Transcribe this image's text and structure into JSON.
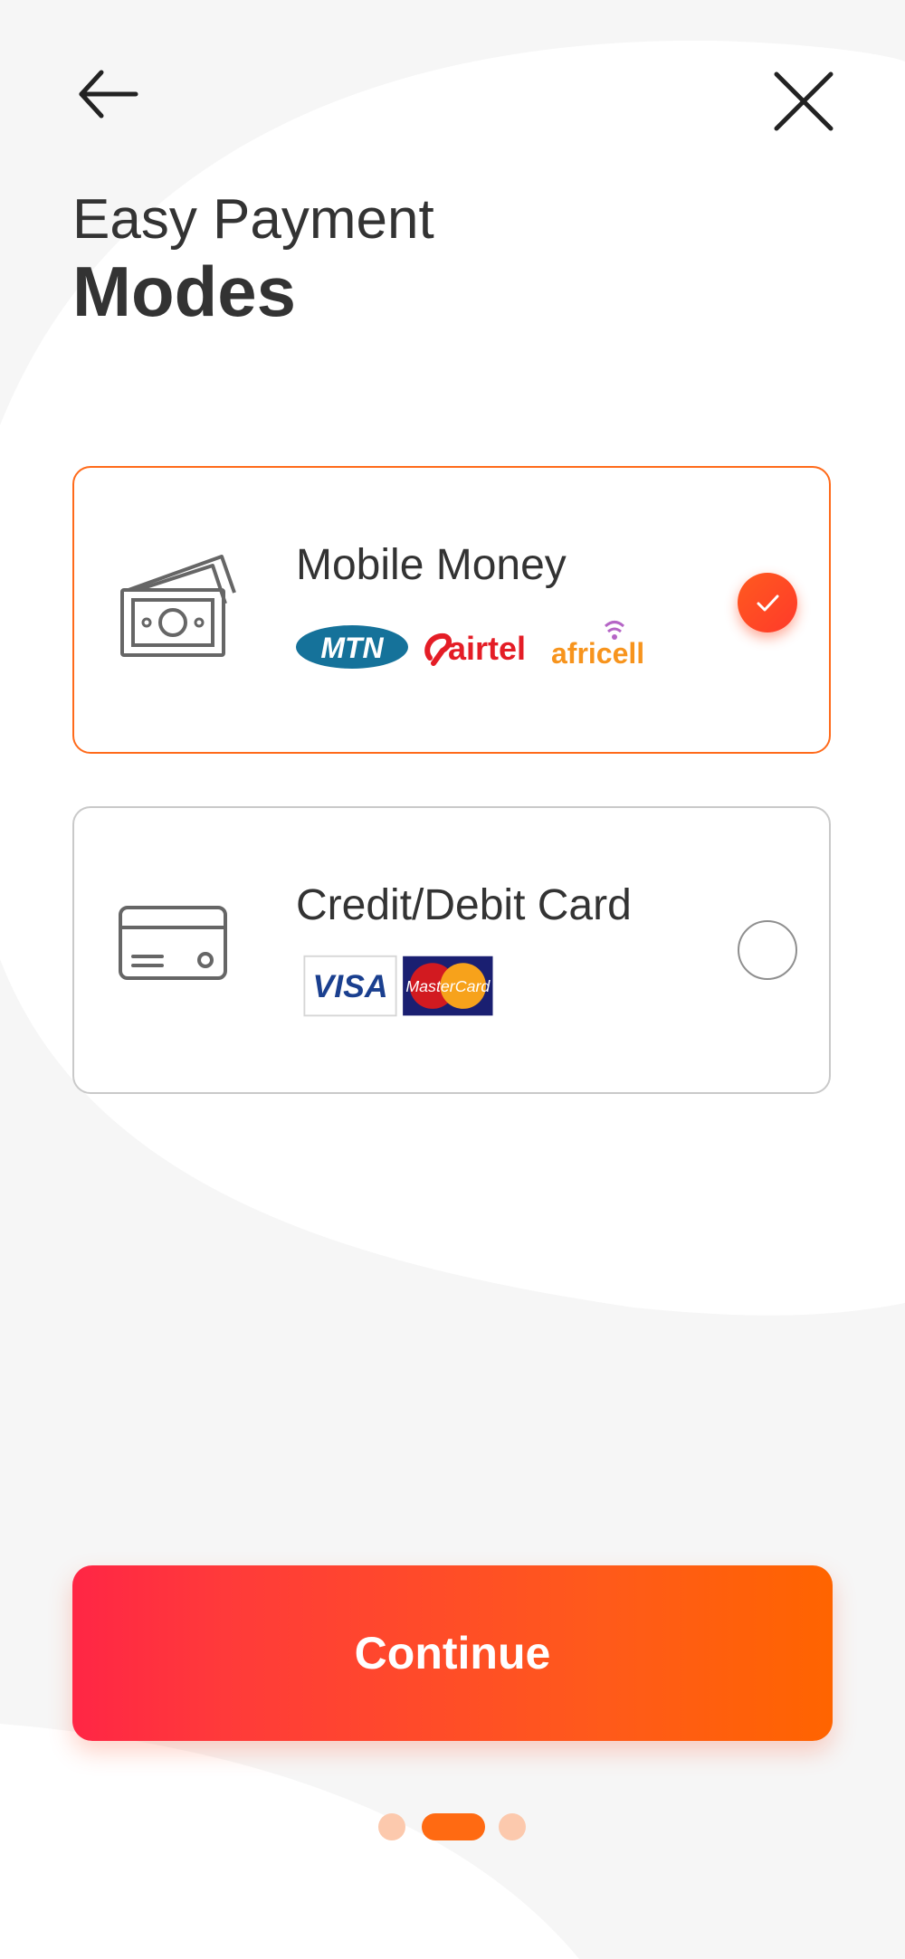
{
  "header": {
    "back_icon": "arrow-left-icon",
    "close_icon": "close-icon"
  },
  "title": {
    "line1": "Easy Payment",
    "line2": "Modes"
  },
  "options": [
    {
      "label": "Mobile Money",
      "icon": "cash-icon",
      "selected": true,
      "logos": [
        "MTN",
        "airtel",
        "africell"
      ]
    },
    {
      "label": "Credit/Debit Card",
      "icon": "credit-card-icon",
      "selected": false,
      "logos": [
        "VISA",
        "MasterCard"
      ]
    }
  ],
  "continue_label": "Continue",
  "pagination": {
    "total": 3,
    "current": 2
  },
  "colors": {
    "accent": "#ff6a12",
    "accent_start": "#ff2645",
    "dot_inactive": "#fcc9ad",
    "background": "#f6f6f6",
    "text": "#333333"
  }
}
